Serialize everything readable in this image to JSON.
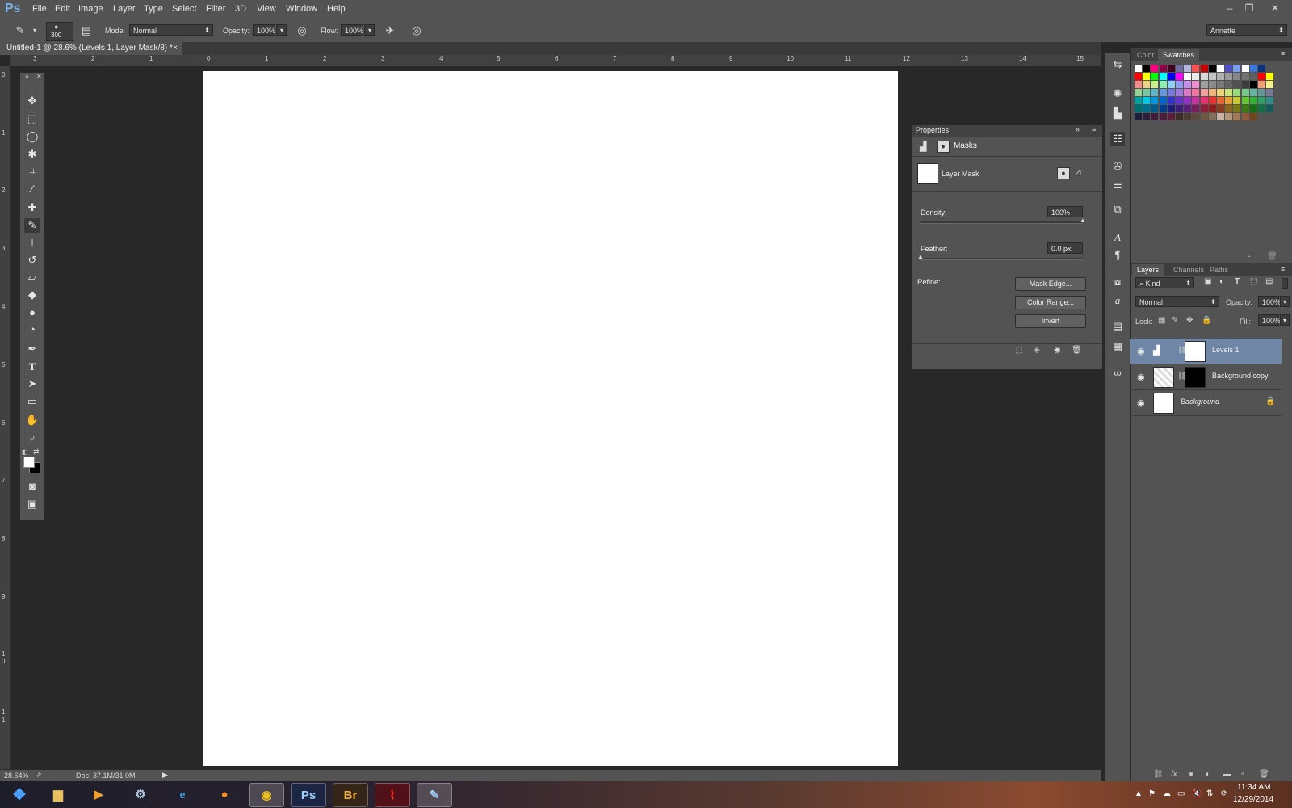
{
  "app": {
    "logo": "Ps"
  },
  "menu": [
    "File",
    "Edit",
    "Image",
    "Layer",
    "Type",
    "Select",
    "Filter",
    "3D",
    "View",
    "Window",
    "Help"
  ],
  "window_controls": {
    "minimize": "–",
    "restore": "❐",
    "close": "✕"
  },
  "options_bar": {
    "brush_size": "300",
    "mode_label": "Mode:",
    "mode_value": "Normal",
    "opacity_label": "Opacity:",
    "opacity_value": "100%",
    "flow_label": "Flow:",
    "flow_value": "100%",
    "workspace": "Annette"
  },
  "document": {
    "tab_title": "Untitled-1 @ 28.6% (Levels 1, Layer Mask/8) *",
    "close": "×"
  },
  "ruler_top": [
    "3",
    "2",
    "1",
    "0",
    "1",
    "2",
    "3",
    "4",
    "5",
    "6",
    "7",
    "8",
    "9",
    "10",
    "11",
    "12",
    "13",
    "14",
    "15"
  ],
  "ruler_left": [
    "0",
    "1",
    "2",
    "3",
    "4",
    "5",
    "6",
    "7",
    "8",
    "9",
    "1 0",
    "1 1"
  ],
  "color_panel": {
    "tabs": [
      "Color",
      "Swatches"
    ],
    "active_tab": "Swatches"
  },
  "properties_panel": {
    "title": "Properties",
    "section": "Masks",
    "mask_label": "Layer Mask",
    "density_label": "Density:",
    "density_value": "100%",
    "density_level": 1.0,
    "feather_label": "Feather:",
    "feather_value": "0.0 px",
    "feather_level": 0.0,
    "refine_label": "Refine:",
    "buttons": [
      "Mask Edge...",
      "Color Range...",
      "Invert"
    ]
  },
  "layers_panel": {
    "tabs": [
      "Layers",
      "Channels",
      "Paths"
    ],
    "active_tab": "Layers",
    "filter_kind": "Kind",
    "blend_mode": "Normal",
    "opacity_label": "Opacity:",
    "opacity_value": "100%",
    "lock_label": "Lock:",
    "fill_label": "Fill:",
    "fill_value": "100%",
    "layers": [
      {
        "name": "Levels 1",
        "selected": true
      },
      {
        "name": "Background copy",
        "selected": false
      },
      {
        "name": "Background",
        "selected": false,
        "locked": true
      }
    ]
  },
  "status_bar": {
    "zoom": "28.64%",
    "doc_info": "Doc: 37.1M/31.0M"
  },
  "taskbar": {
    "apps": [
      "Files",
      "Media",
      "Steam",
      "IE",
      "Firefox",
      "Chrome",
      "Ps",
      "Br",
      "Acrobat",
      "Paint"
    ],
    "time": "11:34 AM",
    "date": "12/29/2014"
  },
  "colors": {
    "ui_bg": "#535353",
    "canvas": "#ffffff",
    "selected_layer": "#6f86a6",
    "accent": "#7fb2e5"
  }
}
